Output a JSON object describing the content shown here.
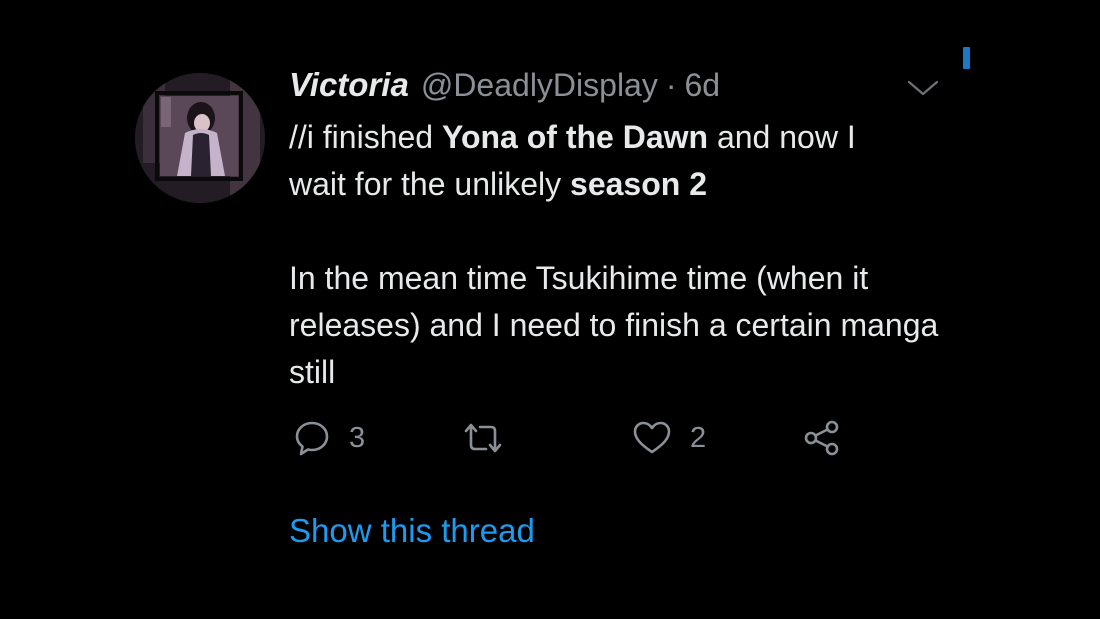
{
  "tweet": {
    "display_name": "Victoria",
    "handle": "@DeadlyDisplay",
    "separator": "·",
    "age": "6d",
    "body": {
      "line1_prefix": "//i finished ",
      "line1_bold": "Yona of the Dawn",
      "line1_suffix": " and now I",
      "line2_prefix": "wait for the unlikely ",
      "line2_bold": "season 2",
      "para2": "In the mean time Tsukihime time (when it releases) and I need to finish a certain manga still"
    },
    "actions": {
      "reply_count": "3",
      "retweet_count": "",
      "like_count": "2"
    },
    "thread_link": "Show this thread"
  },
  "colors": {
    "background": "#000000",
    "text": "#e7e9ea",
    "secondary_text": "#8b9096",
    "link": "#1d9bf0"
  },
  "icons": {
    "reply": "reply-icon",
    "retweet": "retweet-icon",
    "like": "heart-icon",
    "share": "share-icon",
    "menu": "chevron-down-icon"
  }
}
